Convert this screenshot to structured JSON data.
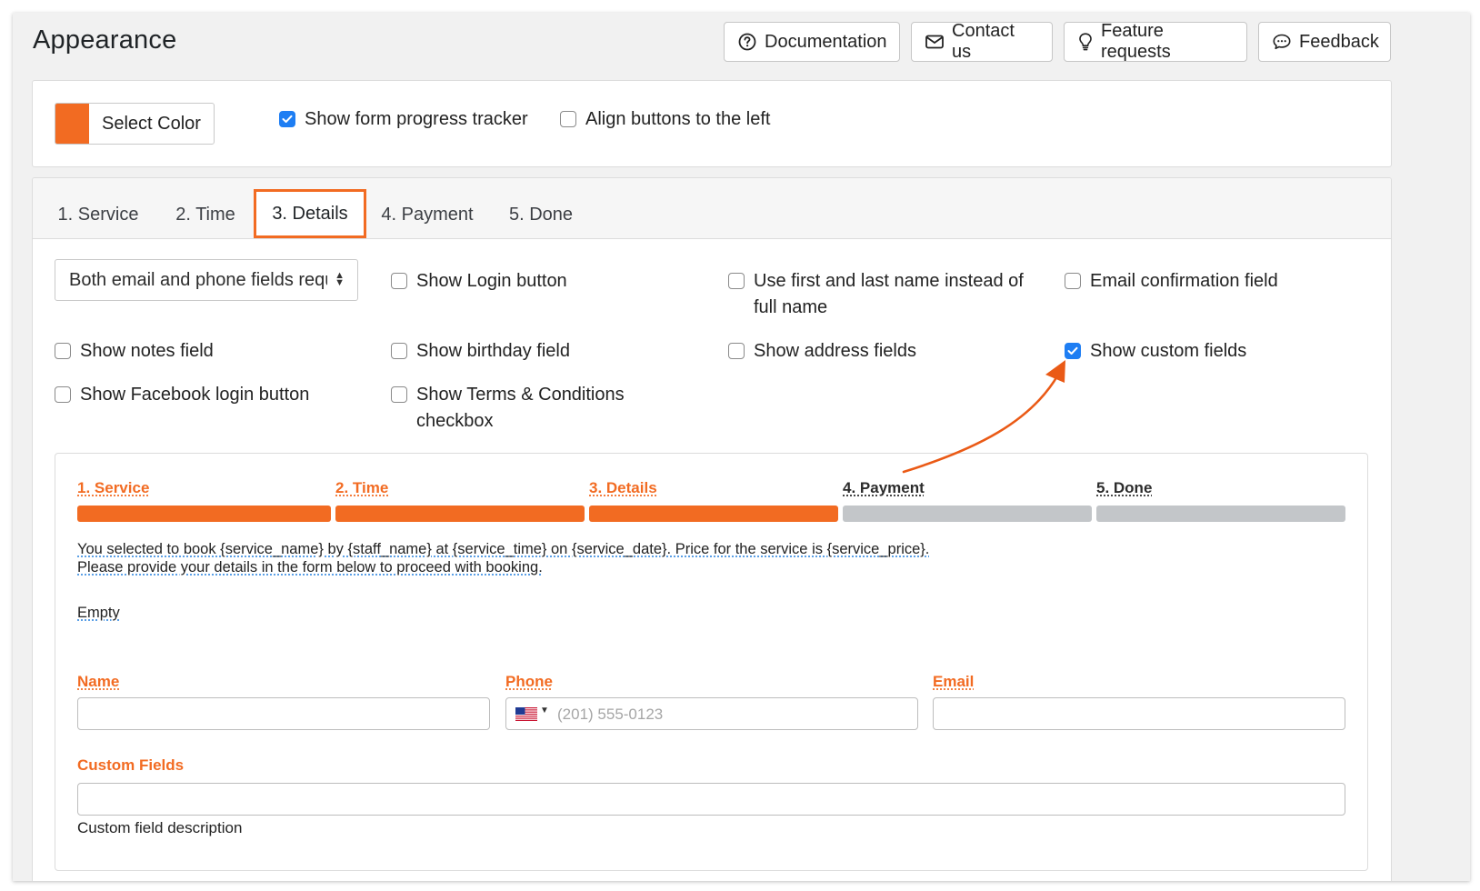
{
  "header": {
    "title": "Appearance",
    "buttons": [
      {
        "label": "Documentation",
        "icon": "question-circle-icon"
      },
      {
        "label": "Contact us",
        "icon": "envelope-icon"
      },
      {
        "label": "Feature requests",
        "icon": "lightbulb-icon"
      },
      {
        "label": "Feedback",
        "icon": "chat-bubble-icon"
      }
    ]
  },
  "general": {
    "select_color_label": "Select Color",
    "accent_color": "#f26b22",
    "show_progress_tracker": {
      "label": "Show form progress tracker",
      "checked": true
    },
    "align_buttons_left": {
      "label": "Align buttons to the left",
      "checked": false
    }
  },
  "tabs": [
    {
      "label": "1. Service",
      "active": false
    },
    {
      "label": "2. Time",
      "active": false
    },
    {
      "label": "3. Details",
      "active": true
    },
    {
      "label": "4. Payment",
      "active": false
    },
    {
      "label": "5. Done",
      "active": false
    }
  ],
  "details_options": {
    "required_fields_select": "Both email and phone fields required",
    "checkboxes": [
      {
        "label": "Show Login button",
        "checked": false
      },
      {
        "label": "Use first and last name instead of full name",
        "checked": false
      },
      {
        "label": "Email confirmation field",
        "checked": false
      },
      {
        "label": "Show notes field",
        "checked": false
      },
      {
        "label": "Show birthday field",
        "checked": false
      },
      {
        "label": "Show address fields",
        "checked": false
      },
      {
        "label": "Show custom fields",
        "checked": true
      },
      {
        "label": "Show Facebook login button",
        "checked": false
      },
      {
        "label": "Show Terms & Conditions checkbox",
        "checked": false
      }
    ]
  },
  "preview": {
    "steps": [
      {
        "label": "1. Service",
        "completed": true
      },
      {
        "label": "2. Time",
        "completed": true
      },
      {
        "label": "3. Details",
        "completed": true
      },
      {
        "label": "4. Payment",
        "completed": false
      },
      {
        "label": "5. Done",
        "completed": false
      }
    ],
    "info_line1": "You selected to book {service_name} by {staff_name} at {service_time} on {service_date}. Price for the service is {service_price}.",
    "info_line2": "Please provide your details in the form below to proceed with booking.",
    "empty_text": "Empty",
    "fields": {
      "name_label": "Name",
      "phone_label": "Phone",
      "phone_placeholder": "(201) 555-0123",
      "phone_flag": "us-flag-icon",
      "email_label": "Email",
      "custom_fields_label": "Custom Fields",
      "custom_field_description": "Custom field description"
    },
    "colors": {
      "active": "#f26b22",
      "inactive_bar": "#c3c6c9",
      "inactive_text": "#2c2c2c"
    }
  },
  "annotation": {
    "arrow_color": "#ea5a16",
    "points_to": "Show custom fields"
  }
}
